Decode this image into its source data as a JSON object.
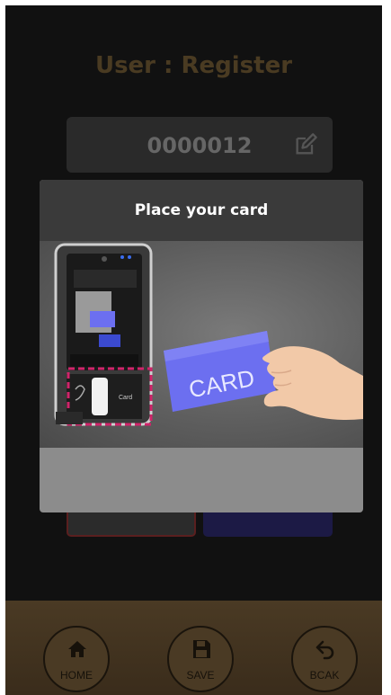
{
  "screen": {
    "title": "User : Register",
    "user_id": "0000012"
  },
  "modal": {
    "title": "Place your card",
    "card_text": "CARD",
    "device_label": "Card"
  },
  "bottom_bar": {
    "home_label": "HOME",
    "save_label": "SAVE",
    "back_label": "BCAK"
  },
  "icons": {
    "edit": "edit-icon",
    "home": "home-icon",
    "save": "floppy-disk-icon",
    "back": "back-arrow-icon"
  },
  "colors": {
    "accent_pink": "#d0246a",
    "card_purple": "#6c6ff0",
    "bar_brown": "#4a3a24"
  }
}
